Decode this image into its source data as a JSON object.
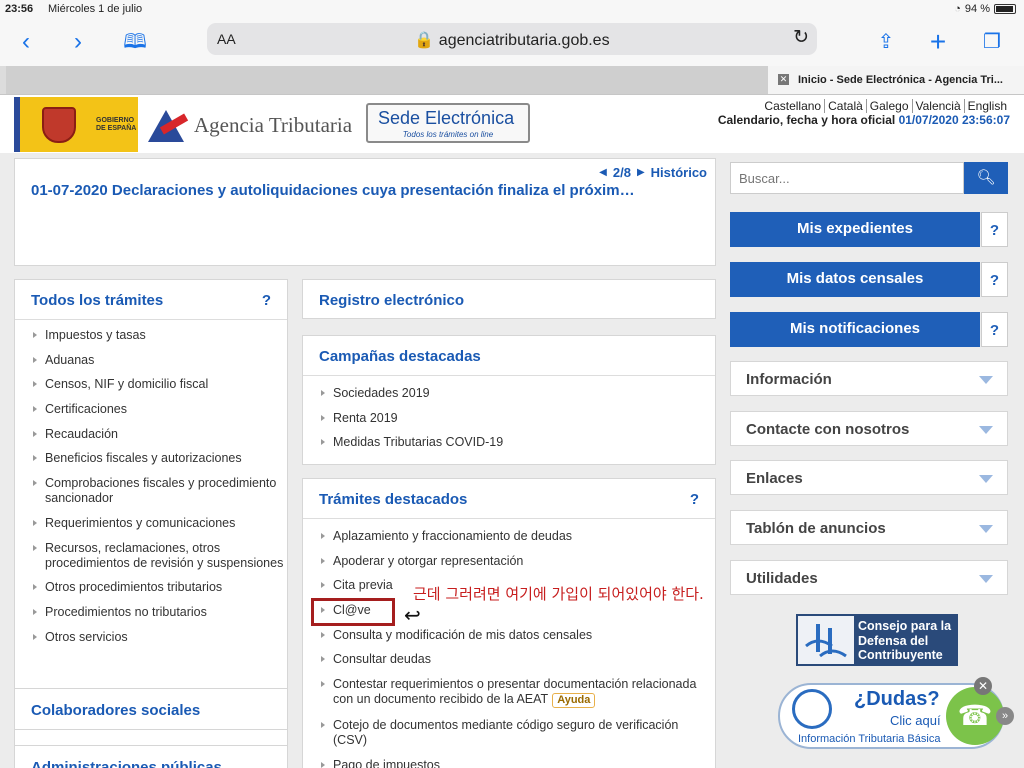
{
  "statusbar": {
    "time": "23:56",
    "date": "Miércoles 1 de julio",
    "battery": "94 %"
  },
  "browser": {
    "aa_label": "AA",
    "url": "agenciatributaria.gob.es",
    "tab_title": "Inicio - Sede Electrónica - Agencia Tri..."
  },
  "header": {
    "gob_text_1": "GOBIERNO",
    "gob_text_2": "DE ESPAÑA",
    "agency": "Agencia Tributaria",
    "sede_big": "Sede Electrónica",
    "sede_small": "Todos los trámites on line",
    "languages": [
      "Castellano",
      "Català",
      "Galego",
      "Valencià",
      "English"
    ],
    "official_label": "Calendario, fecha y hora oficial",
    "official_value": "01/07/2020 23:56:07"
  },
  "news": {
    "pager": "2/8",
    "historico": "Histórico",
    "headline": "01-07-2020  Declaraciones y autoliquidaciones cuya presentación finaliza el próxim…"
  },
  "todos": {
    "title": "Todos los trámites",
    "help": "?",
    "items": [
      "Impuestos y tasas",
      "Aduanas",
      "Censos, NIF y domicilio fiscal",
      "Certificaciones",
      "Recaudación",
      "Beneficios fiscales y autorizaciones",
      "Comprobaciones fiscales y procedimiento sancionador",
      "Requerimientos y comunicaciones",
      "Recursos, reclamaciones, otros procedimientos de revisión y suspensiones",
      "Otros procedimientos tributarios",
      "Procedimientos no tributarios",
      "Otros servicios"
    ]
  },
  "registro": {
    "title": "Registro electrónico"
  },
  "campanas": {
    "title": "Campañas destacadas",
    "items": [
      "Sociedades 2019",
      "Renta 2019",
      "Medidas Tributarias COVID-19"
    ]
  },
  "destacados": {
    "title": "Trámites destacados",
    "help": "?",
    "items": [
      "Aplazamiento y fraccionamiento de deudas",
      "Apoderar y otorgar representación",
      "Cita previa",
      "Cl@ve",
      "Consulta y modificación de mis datos censales",
      "Consultar deudas",
      "Contestar requerimientos o presentar documentación relacionada con un documento recibido de la AEAT",
      "Cotejo de documentos mediante código seguro de verificación (CSV)",
      "Pago de impuestos"
    ],
    "ayuda": "Ayuda"
  },
  "colab": {
    "title": "Colaboradores sociales"
  },
  "admin": {
    "title": "Administraciones públicas"
  },
  "search": {
    "placeholder": "Buscar..."
  },
  "buttons": {
    "expedientes": "Mis expedientes",
    "censales": "Mis datos censales",
    "notificaciones": "Mis notificaciones",
    "help": "?"
  },
  "accordions": [
    "Información",
    "Contacte con nosotros",
    "Enlaces",
    "Tablón de anuncios",
    "Utilidades"
  ],
  "consejo": {
    "line1": "Consejo para la",
    "line2": "Defensa del",
    "line3": "Contribuyente"
  },
  "dudas": {
    "title": "¿Dudas?",
    "sub": "Clic aquí",
    "foot": "Información Tributaria Básica"
  },
  "annotation": {
    "text": "근데 그러려면 여기에 가입이 되어있어야 한다."
  },
  "colors": {
    "brand_blue": "#1a5ab4",
    "button_blue": "#1f5fb8",
    "annotation_red": "#c71e1e"
  }
}
